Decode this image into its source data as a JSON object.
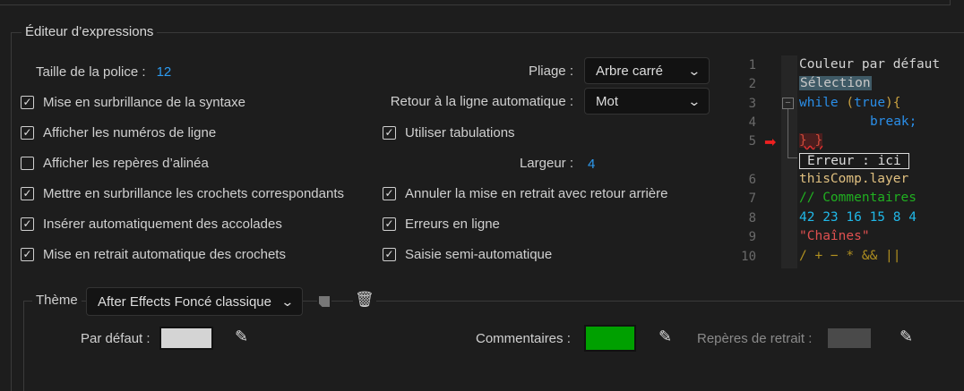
{
  "section_title": "Éditeur d’expressions",
  "font_size": {
    "label": "Taille de la police :",
    "value": "12"
  },
  "left_options": [
    {
      "label": "Mise en surbrillance de la syntaxe",
      "checked": true
    },
    {
      "label": "Afficher les numéros de ligne",
      "checked": true
    },
    {
      "label": "Afficher les repères d’alinéa",
      "checked": false
    },
    {
      "label": "Mettre en surbrillance les crochets correspondants",
      "checked": true
    },
    {
      "label": "Insérer automatiquement des accolades",
      "checked": true
    },
    {
      "label": "Mise en retrait automatique des crochets",
      "checked": true
    }
  ],
  "folding": {
    "label": "Pliage :",
    "value": "Arbre carré"
  },
  "wrap": {
    "label": "Retour à la ligne automatique :",
    "value": "Mot"
  },
  "tabs": {
    "label": "Utiliser tabulations",
    "checked": true
  },
  "width": {
    "label": "Largeur :",
    "value": "4"
  },
  "right_options": [
    {
      "label": "Annuler la mise en retrait avec retour arrière",
      "checked": true
    },
    {
      "label": "Erreurs en ligne",
      "checked": true
    },
    {
      "label": "Saisie semi-automatique",
      "checked": true
    }
  ],
  "preview": {
    "line_numbers": [
      "1",
      "2",
      "3",
      "4",
      "5",
      "6",
      "7",
      "8",
      "9",
      "10"
    ],
    "line1": "Couleur par défaut",
    "line2": "Sélection",
    "line3_kw": "while",
    "line3_p1": " (",
    "line3_true": "true",
    "line3_p2": "){",
    "line4": "break;",
    "line5": "} }",
    "error": "Erreur : ici",
    "line6": "thisComp.layer",
    "line7": "// Commentaires",
    "line8": "42 23 16 15 8 4",
    "line9": "\"Chaînes\"",
    "line10": "/ + − * && ||"
  },
  "theme": {
    "label": "Thème",
    "value": "After Effects Foncé classique"
  },
  "colors": [
    {
      "label": "Par défaut :",
      "color": "#d4d4d4"
    },
    {
      "label": "Commentaires :",
      "color": "#00a000"
    },
    {
      "label": "Repères de retrait :",
      "color": "#4a4a4a"
    }
  ]
}
